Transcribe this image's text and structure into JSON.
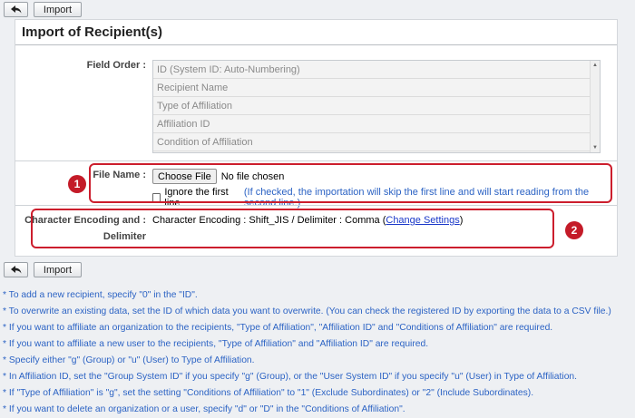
{
  "toolbar": {
    "back_icon": "back-arrow-icon",
    "import_label": "Import"
  },
  "panel": {
    "title": "Import of Recipient(s)"
  },
  "field_order": {
    "label": "Field Order :",
    "items": [
      "ID (System ID: Auto-Numbering)",
      "Recipient Name",
      "Type of Affiliation",
      "Affiliation ID",
      "Condition of Affiliation"
    ]
  },
  "file_name": {
    "label": "File Name :",
    "choose_label": "Choose File",
    "status": "No file chosen",
    "ignore_label": "Ignore the first line",
    "ignore_hint": "(If checked, the importation will skip the first line and will start reading from the second line.)",
    "badge": "1"
  },
  "encoding": {
    "label_line1": "Character Encoding and :",
    "label_line2": "Delimiter",
    "value": "Character Encoding : Shift_JIS / Delimiter : Comma (",
    "change_link": "Change Settings",
    "close_paren": ")",
    "badge": "2"
  },
  "colors": {
    "annotation_red": "#cc1e2d",
    "note_blue": "#2c63c4",
    "link_blue": "#1a38c9"
  },
  "notes": [
    "* To add a new recipient, specify \"0\" in the \"ID\".",
    "* To overwrite an existing data, set the ID of which data you want to overwrite. (You can check the registered ID by exporting the data to a CSV file.)",
    "* If you want to affiliate an organization to the recipients, \"Type of Affiliation\", \"Affiliation ID\" and \"Conditions of Affiliation\" are required.",
    "* If you want to affiliate a new user to the recipients, \"Type of Affiliation\" and \"Affiliation ID\" are required.",
    "* Specify either \"g\" (Group) or \"u\" (User) to Type of Affiliation.",
    "* In Affiliation ID, set the \"Group System ID\" if you specify \"g\" (Group), or the \"User System ID\" if you specify \"u\" (User) in Type of Affiliation.",
    "* If \"Type of Affiliation\" is \"g\", set the setting \"Conditions of Affiliation\" to \"1\" (Exclude Subordinates) or \"2\" (Include Subordinates).",
    "* If you want to delete an organization or a user, specify \"d\" or \"D\" in the \"Conditions of Affiliation\"."
  ]
}
